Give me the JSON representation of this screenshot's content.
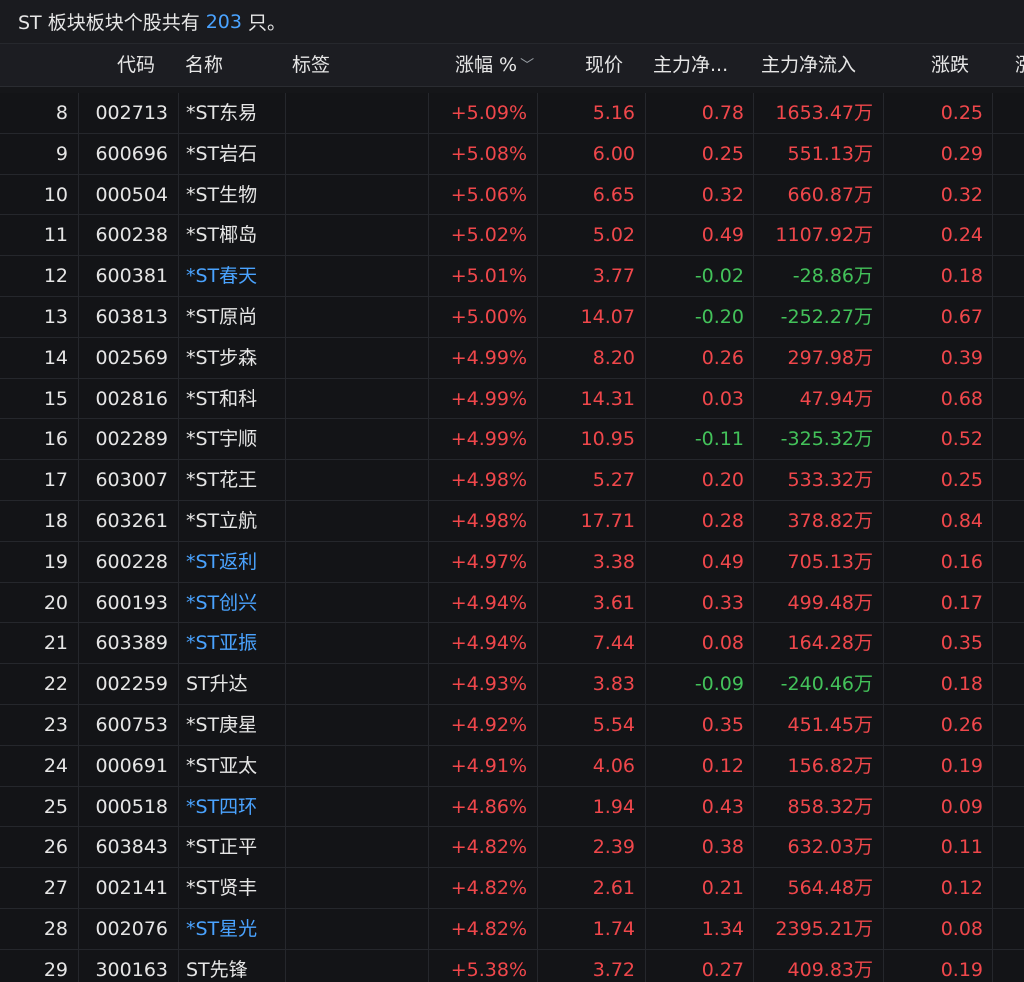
{
  "topbar": {
    "prefix": "ST 板块板块个股共有",
    "count": "203",
    "suffix": "只。"
  },
  "header": {
    "code": "代码",
    "name": "名称",
    "tag": "标签",
    "change_pct": "涨幅 %",
    "price": "现价",
    "main_net": "主力净...",
    "main_net_inflow": "主力净流入",
    "diff": "涨跌",
    "partial": "涨"
  },
  "colors": {
    "up": "#f0474b",
    "down": "#43c25a",
    "highlight_name": "#4aa3ff"
  },
  "rows": [
    {
      "idx": "8",
      "code": "002713",
      "name": "*ST东易",
      "hl": false,
      "chg": "+5.09%",
      "price": "5.16",
      "main": "0.78",
      "flow": "1653.47万",
      "diff": "0.25"
    },
    {
      "idx": "9",
      "code": "600696",
      "name": "*ST岩石",
      "hl": false,
      "chg": "+5.08%",
      "price": "6.00",
      "main": "0.25",
      "flow": "551.13万",
      "diff": "0.29"
    },
    {
      "idx": "10",
      "code": "000504",
      "name": "*ST生物",
      "hl": false,
      "chg": "+5.06%",
      "price": "6.65",
      "main": "0.32",
      "flow": "660.87万",
      "diff": "0.32"
    },
    {
      "idx": "11",
      "code": "600238",
      "name": "*ST椰岛",
      "hl": false,
      "chg": "+5.02%",
      "price": "5.02",
      "main": "0.49",
      "flow": "1107.92万",
      "diff": "0.24"
    },
    {
      "idx": "12",
      "code": "600381",
      "name": "*ST春天",
      "hl": true,
      "chg": "+5.01%",
      "price": "3.77",
      "main": "-0.02",
      "flow": "-28.86万",
      "diff": "0.18"
    },
    {
      "idx": "13",
      "code": "603813",
      "name": "*ST原尚",
      "hl": false,
      "chg": "+5.00%",
      "price": "14.07",
      "main": "-0.20",
      "flow": "-252.27万",
      "diff": "0.67"
    },
    {
      "idx": "14",
      "code": "002569",
      "name": "*ST步森",
      "hl": false,
      "chg": "+4.99%",
      "price": "8.20",
      "main": "0.26",
      "flow": "297.98万",
      "diff": "0.39"
    },
    {
      "idx": "15",
      "code": "002816",
      "name": "*ST和科",
      "hl": false,
      "chg": "+4.99%",
      "price": "14.31",
      "main": "0.03",
      "flow": "47.94万",
      "diff": "0.68"
    },
    {
      "idx": "16",
      "code": "002289",
      "name": "*ST宇顺",
      "hl": false,
      "chg": "+4.99%",
      "price": "10.95",
      "main": "-0.11",
      "flow": "-325.32万",
      "diff": "0.52"
    },
    {
      "idx": "17",
      "code": "603007",
      "name": "*ST花王",
      "hl": false,
      "chg": "+4.98%",
      "price": "5.27",
      "main": "0.20",
      "flow": "533.32万",
      "diff": "0.25"
    },
    {
      "idx": "18",
      "code": "603261",
      "name": "*ST立航",
      "hl": false,
      "chg": "+4.98%",
      "price": "17.71",
      "main": "0.28",
      "flow": "378.82万",
      "diff": "0.84"
    },
    {
      "idx": "19",
      "code": "600228",
      "name": "*ST返利",
      "hl": true,
      "chg": "+4.97%",
      "price": "3.38",
      "main": "0.49",
      "flow": "705.13万",
      "diff": "0.16"
    },
    {
      "idx": "20",
      "code": "600193",
      "name": "*ST创兴",
      "hl": true,
      "chg": "+4.94%",
      "price": "3.61",
      "main": "0.33",
      "flow": "499.48万",
      "diff": "0.17"
    },
    {
      "idx": "21",
      "code": "603389",
      "name": "*ST亚振",
      "hl": true,
      "chg": "+4.94%",
      "price": "7.44",
      "main": "0.08",
      "flow": "164.28万",
      "diff": "0.35"
    },
    {
      "idx": "22",
      "code": "002259",
      "name": "ST升达",
      "hl": false,
      "chg": "+4.93%",
      "price": "3.83",
      "main": "-0.09",
      "flow": "-240.46万",
      "diff": "0.18"
    },
    {
      "idx": "23",
      "code": "600753",
      "name": "*ST庚星",
      "hl": false,
      "chg": "+4.92%",
      "price": "5.54",
      "main": "0.35",
      "flow": "451.45万",
      "diff": "0.26"
    },
    {
      "idx": "24",
      "code": "000691",
      "name": "*ST亚太",
      "hl": false,
      "chg": "+4.91%",
      "price": "4.06",
      "main": "0.12",
      "flow": "156.82万",
      "diff": "0.19"
    },
    {
      "idx": "25",
      "code": "000518",
      "name": "*ST四环",
      "hl": true,
      "chg": "+4.86%",
      "price": "1.94",
      "main": "0.43",
      "flow": "858.32万",
      "diff": "0.09"
    },
    {
      "idx": "26",
      "code": "603843",
      "name": "*ST正平",
      "hl": false,
      "chg": "+4.82%",
      "price": "2.39",
      "main": "0.38",
      "flow": "632.03万",
      "diff": "0.11"
    },
    {
      "idx": "27",
      "code": "002141",
      "name": "*ST贤丰",
      "hl": false,
      "chg": "+4.82%",
      "price": "2.61",
      "main": "0.21",
      "flow": "564.48万",
      "diff": "0.12"
    },
    {
      "idx": "28",
      "code": "002076",
      "name": "*ST星光",
      "hl": true,
      "chg": "+4.82%",
      "price": "1.74",
      "main": "1.34",
      "flow": "2395.21万",
      "diff": "0.08"
    },
    {
      "idx": "29",
      "code": "300163",
      "name": "ST先锋",
      "hl": false,
      "chg": "+5.38%",
      "price": "3.72",
      "main": "0.27",
      "flow": "409.83万",
      "diff": "0.19"
    }
  ]
}
